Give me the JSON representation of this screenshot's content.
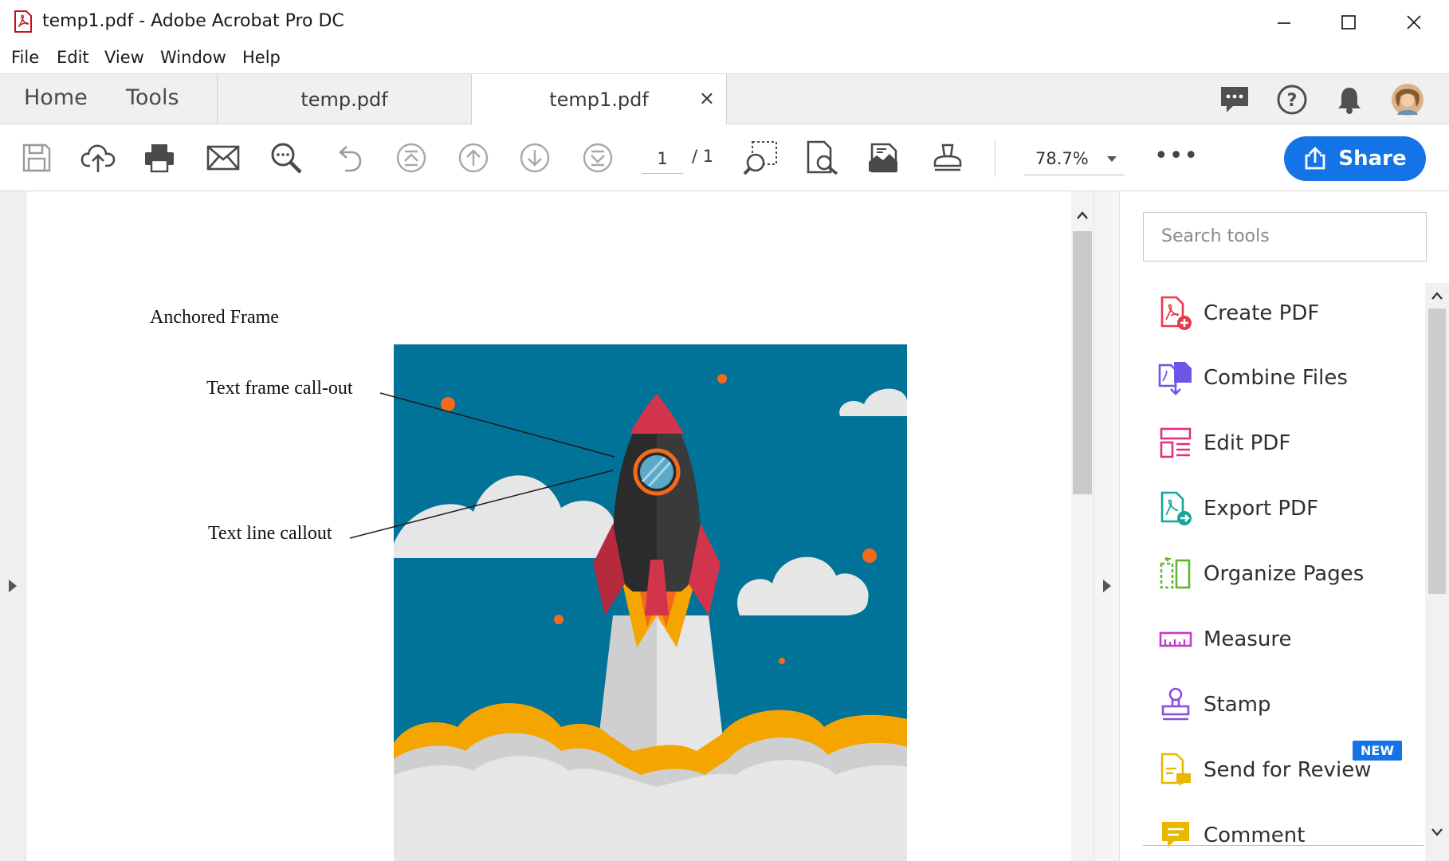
{
  "window": {
    "title": "temp1.pdf - Adobe Acrobat Pro DC",
    "controls": [
      "minimize-icon",
      "maximize-icon",
      "close-icon"
    ]
  },
  "menu": [
    "File",
    "Edit",
    "View",
    "Window",
    "Help"
  ],
  "tabs": {
    "nav": [
      "Home",
      "Tools"
    ],
    "documents": [
      {
        "label": "temp.pdf",
        "active": false
      },
      {
        "label": "temp1.pdf",
        "active": true,
        "close": "×"
      }
    ],
    "right_icons": [
      "comment-bubble-icon",
      "help-icon",
      "bell-icon",
      "avatar"
    ]
  },
  "toolbar": {
    "page_current": "1",
    "page_total": "/ 1",
    "zoom": "78.7%",
    "more": "•••",
    "share_label": "Share",
    "icons": [
      "save-icon",
      "cloud-upload-icon",
      "print-icon",
      "mail-icon",
      "zoom-search-icon",
      "undo-icon",
      "first-page-icon",
      "prev-page-icon",
      "next-page-icon",
      "last-page-icon",
      "marquee-zoom-icon",
      "find-icon",
      "scan-icon",
      "stamp-tool-icon"
    ]
  },
  "document": {
    "heading": "Anchored Frame",
    "callout_frame": "Text frame call-out",
    "callout_line": "Text line callout",
    "colors": {
      "sky": "#017398",
      "cloud": "#e6e6e6",
      "flame": "#f5a500",
      "rocket_body": "#2b2b2b",
      "rocket_red": "#d2344b"
    }
  },
  "panel": {
    "search_placeholder": "Search tools",
    "tools": [
      {
        "label": "Create PDF",
        "icon": "create-pdf-icon",
        "color": "#e8394a"
      },
      {
        "label": "Combine Files",
        "icon": "combine-files-icon",
        "color": "#6d55e8"
      },
      {
        "label": "Edit PDF",
        "icon": "edit-pdf-icon",
        "color": "#e0317f"
      },
      {
        "label": "Export PDF",
        "icon": "export-pdf-icon",
        "color": "#13a69a"
      },
      {
        "label": "Organize Pages",
        "icon": "organize-pages-icon",
        "color": "#5fb92e"
      },
      {
        "label": "Measure",
        "icon": "measure-icon",
        "color": "#c039cc"
      },
      {
        "label": "Stamp",
        "icon": "stamp-icon",
        "color": "#8d4fd6"
      },
      {
        "label": "Send for Review",
        "icon": "send-review-icon",
        "color": "#e6b800"
      },
      {
        "label": "Comment",
        "icon": "comment-icon",
        "color": "#e6b800"
      }
    ],
    "new_badge": "NEW"
  }
}
